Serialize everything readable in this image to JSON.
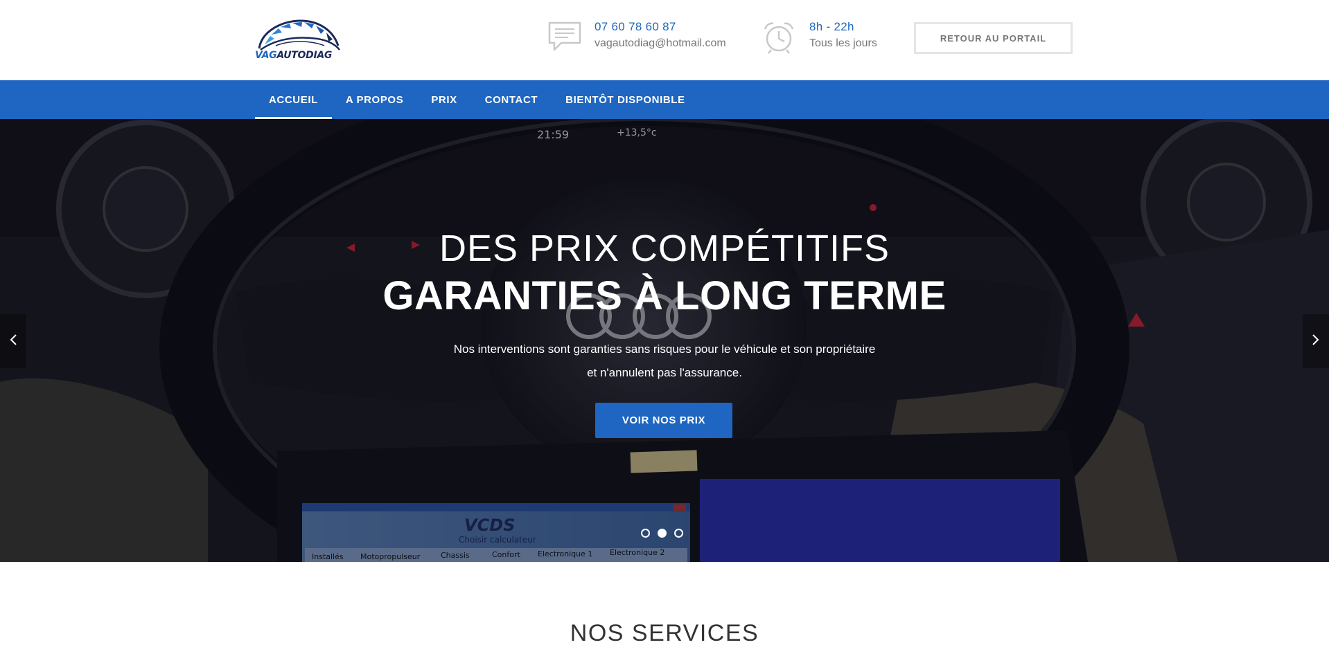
{
  "brand": {
    "name_part1": "VAG",
    "name_part2": "AUTODIAG",
    "colors": {
      "primary": "#1e66c1",
      "dark": "#1b2a5a"
    }
  },
  "header": {
    "phone": {
      "icon": "message-icon",
      "title": "07 60 78 60 87",
      "subtitle": "vagautodiag@hotmail.com"
    },
    "hours": {
      "icon": "alarm-clock-icon",
      "title": "8h - 22h",
      "subtitle": "Tous les jours"
    },
    "portal_button": "RETOUR AU PORTAIL"
  },
  "nav": {
    "items": [
      {
        "label": "ACCUEIL",
        "active": true
      },
      {
        "label": "A PROPOS"
      },
      {
        "label": "PRIX"
      },
      {
        "label": "CONTACT"
      },
      {
        "label": "BIENTÔT DISPONIBLE"
      }
    ]
  },
  "hero": {
    "title_line1": "DES PRIX COMPÉTITIFS",
    "title_line2": "GARANTIES À LONG TERME",
    "desc_line1": "Nos interventions sont garanties sans risques pour le véhicule et son propriétaire",
    "desc_line2": "et n'annulent pas l'assurance.",
    "button": "VOIR NOS PRIX",
    "prev_icon": "chevron-left-icon",
    "next_icon": "chevron-right-icon",
    "slides_count": 3,
    "active_slide": 2,
    "screen_brand": "VCDS",
    "screen_subtitle": "Choisir calculateur",
    "screen_tabs": [
      "Installés",
      "Motopropulseur",
      "Chassis",
      "Confort",
      "Electronique 1",
      "Electronique 2"
    ],
    "dash_time": "21:59",
    "dash_temp": "+13,5°c"
  },
  "services": {
    "title": "NOS SERVICES"
  }
}
